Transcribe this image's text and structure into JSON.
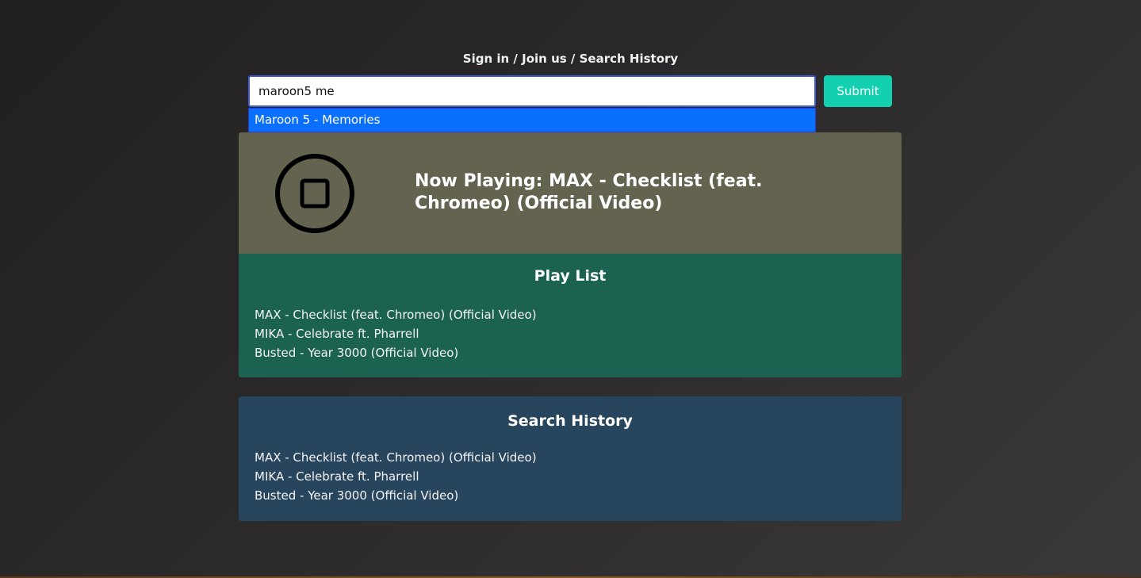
{
  "nav": {
    "sign_in": "Sign in",
    "join_us": "Join us",
    "search_history": "Search History",
    "separator": " / "
  },
  "search": {
    "value": "maroon5 me",
    "suggestion": "Maroon 5 - Memories",
    "submit_label": "Submit"
  },
  "player": {
    "icon": "stop-icon",
    "now_playing": "Now Playing: MAX - Checklist (feat. Chromeo) (Official Video)"
  },
  "playlist": {
    "title": "Play List",
    "items": [
      "MAX - Checklist (feat. Chromeo) (Official Video)",
      "MIKA - Celebrate ft. Pharrell",
      "Busted - Year 3000 (Official Video)"
    ]
  },
  "history": {
    "title": "Search History",
    "items": [
      "MAX - Checklist (feat. Chromeo) (Official Video)",
      "MIKA - Celebrate ft. Pharrell",
      "Busted - Year 3000 (Official Video)"
    ]
  },
  "colors": {
    "submit": "#13d1b0",
    "suggestion_highlight": "#0b6ffd",
    "now_playing_bg": "#636350",
    "playlist_bg": "#1c6250",
    "history_bg": "#28455e"
  }
}
